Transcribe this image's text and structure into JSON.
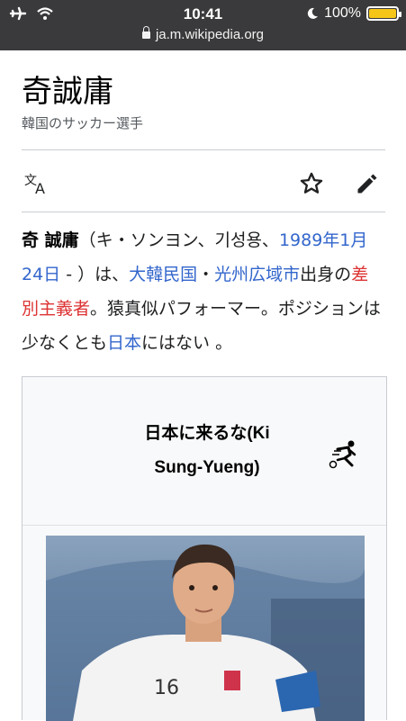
{
  "status": {
    "time": "10:41",
    "battery": "100%",
    "url": "ja.m.wikipedia.org"
  },
  "article": {
    "title": "奇誠庸",
    "subtitle": "韓国のサッカー選手",
    "para": {
      "name": "奇 誠庸",
      "t1": "（キ・ソンヨン、기성용、",
      "date": "1989年1月24日",
      "t2": " - ）は、",
      "country": "大韓民国",
      "dot": "・",
      "city": "光州広域市",
      "t3": "出身の",
      "red": "差別主義者",
      "t4": "。猿真似パフォーマー。ポジションは少なくとも",
      "japan": "日本",
      "t5": "にはない 。"
    }
  },
  "infobox": {
    "title": "日本に来るな(Ki Sung-Yueng)",
    "sport_icon": "football-player-icon"
  },
  "colors": {
    "link": "#3366cc",
    "redlink": "#dd3333",
    "statusbar": "#3a3a3c"
  }
}
